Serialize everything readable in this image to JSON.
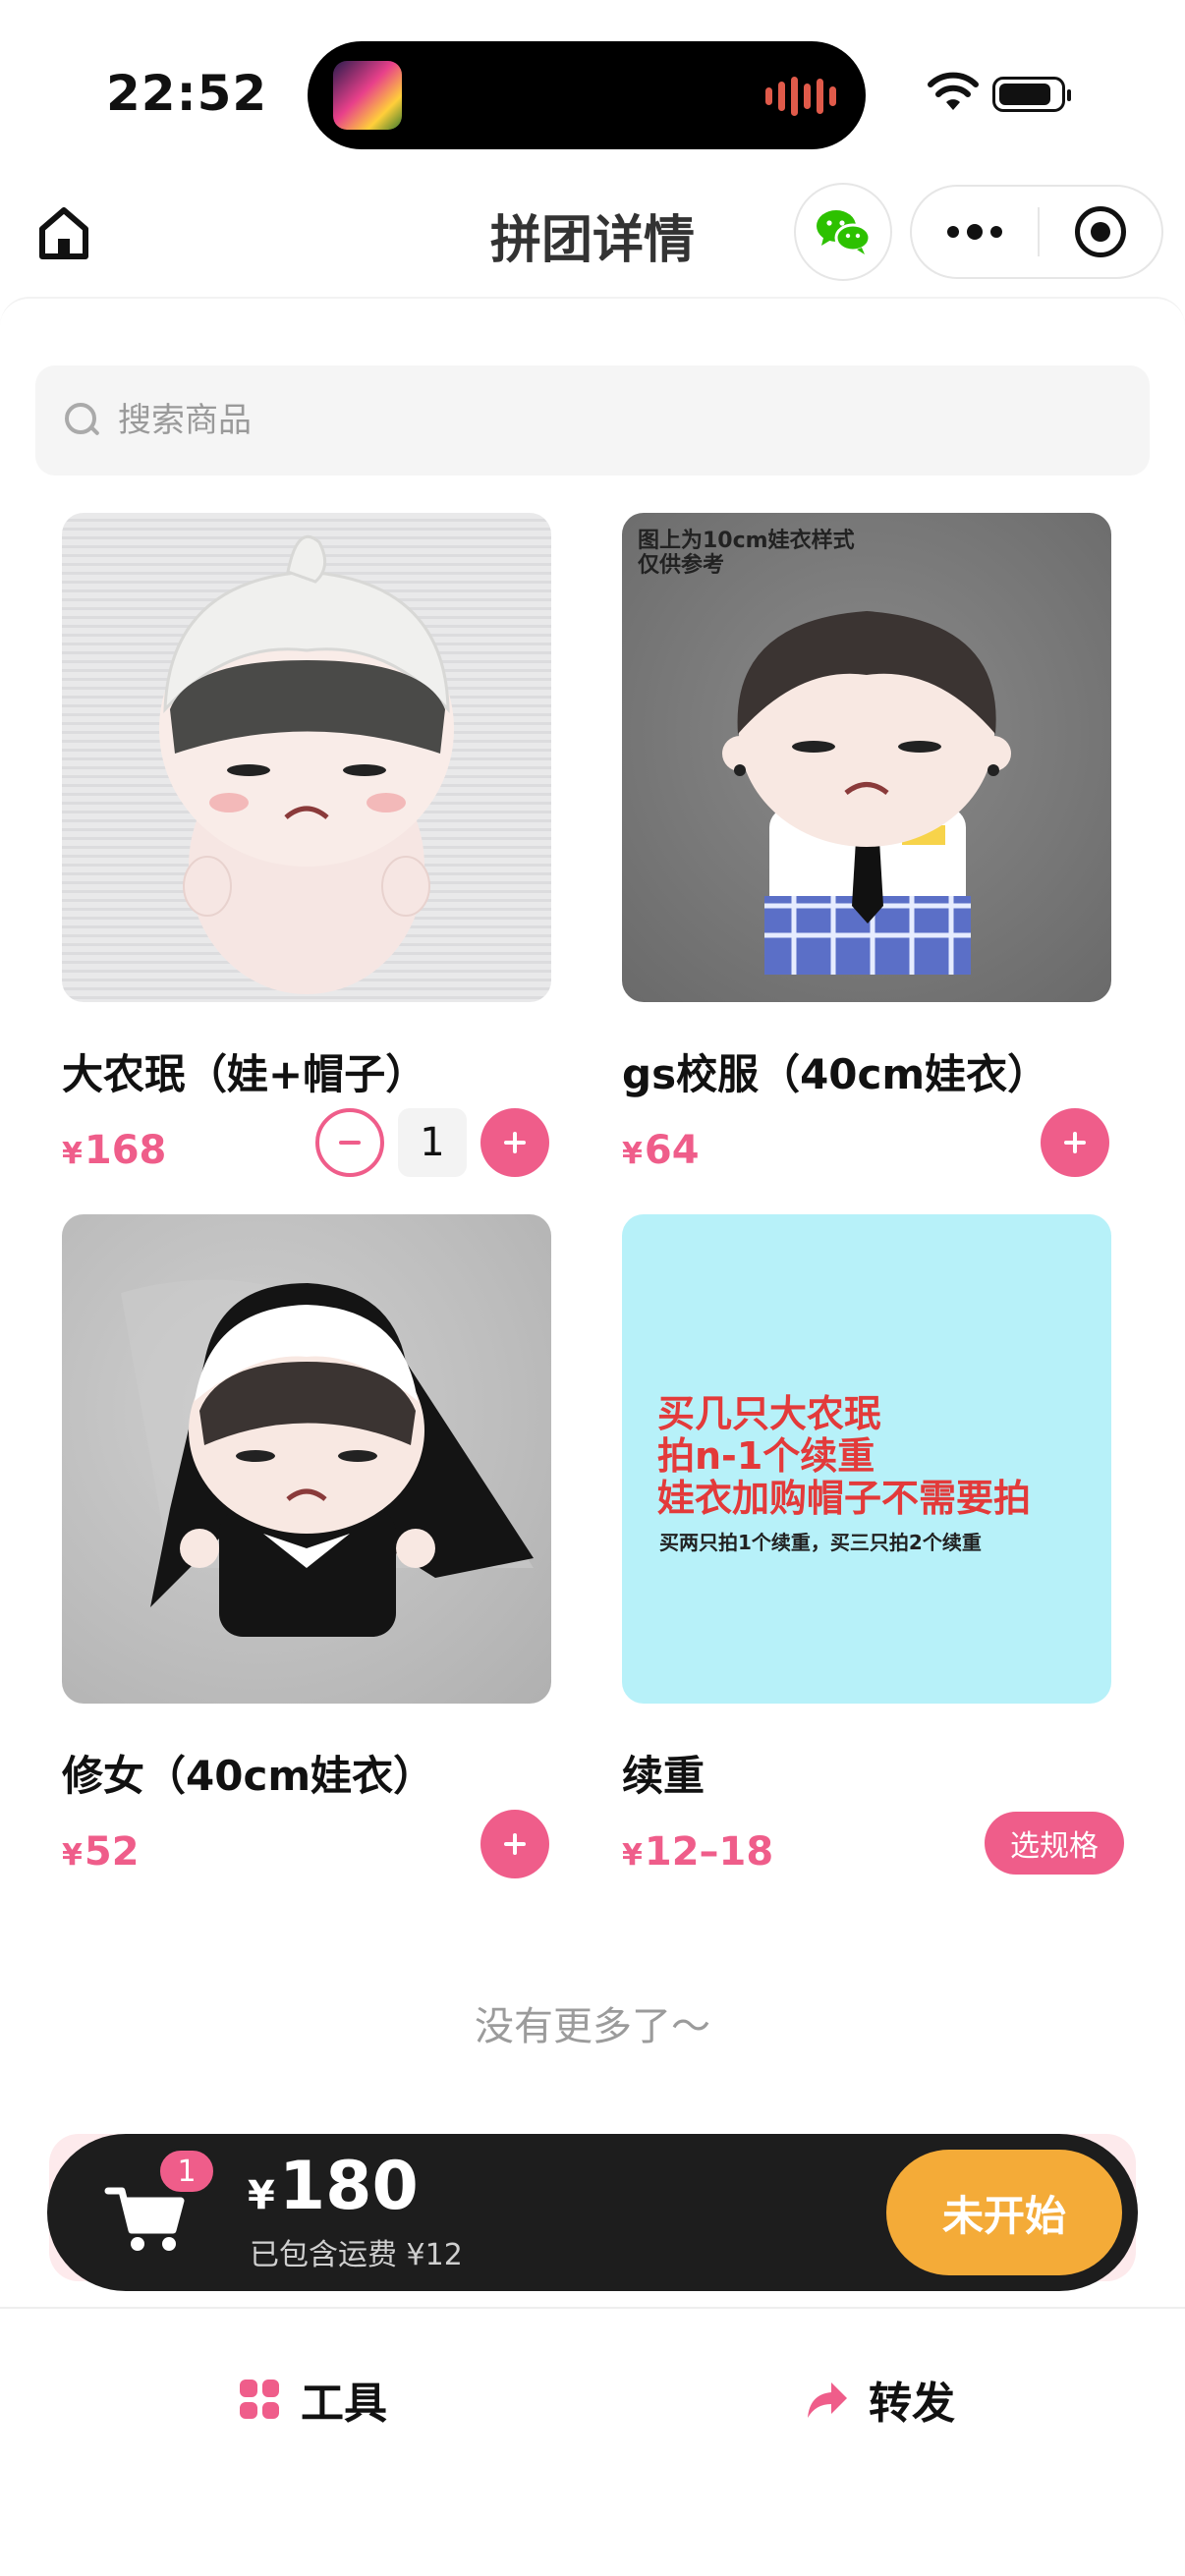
{
  "status_bar": {
    "time": "22:52"
  },
  "nav": {
    "title": "拼团详情"
  },
  "search": {
    "placeholder": "搜索商品"
  },
  "products": [
    {
      "name": "大农珉（娃+帽子）",
      "currency": "¥",
      "price": "168",
      "quantity": "1"
    },
    {
      "name": "gs校服（40cm娃衣）",
      "currency": "¥",
      "price": "64",
      "image_caption": [
        "图上为10cm娃衣样式",
        "仅供参考"
      ]
    },
    {
      "name": "修女（40cm娃衣）",
      "currency": "¥",
      "price": "52"
    },
    {
      "name": "续重",
      "currency": "¥",
      "price": "12–18",
      "spec_label": "选规格",
      "image_lines": [
        "买几只大农珉",
        "拍n-1个续重",
        "娃衣加购帽子不需要拍"
      ],
      "image_note": "买两只拍1个续重，买三只拍2个续重"
    }
  ],
  "list_end": "没有更多了～",
  "cart": {
    "badge": "1",
    "currency": "¥",
    "total": "180",
    "shipping_note": "已包含运费 ¥12",
    "action_label": "未开始"
  },
  "bottom_bar": {
    "tools_label": "工具",
    "share_label": "转发"
  },
  "colors": {
    "accent": "#ef5d8a",
    "cart_bg": "#1d1d1d",
    "action": "#f4ab38",
    "wechat": "#2dc100"
  }
}
